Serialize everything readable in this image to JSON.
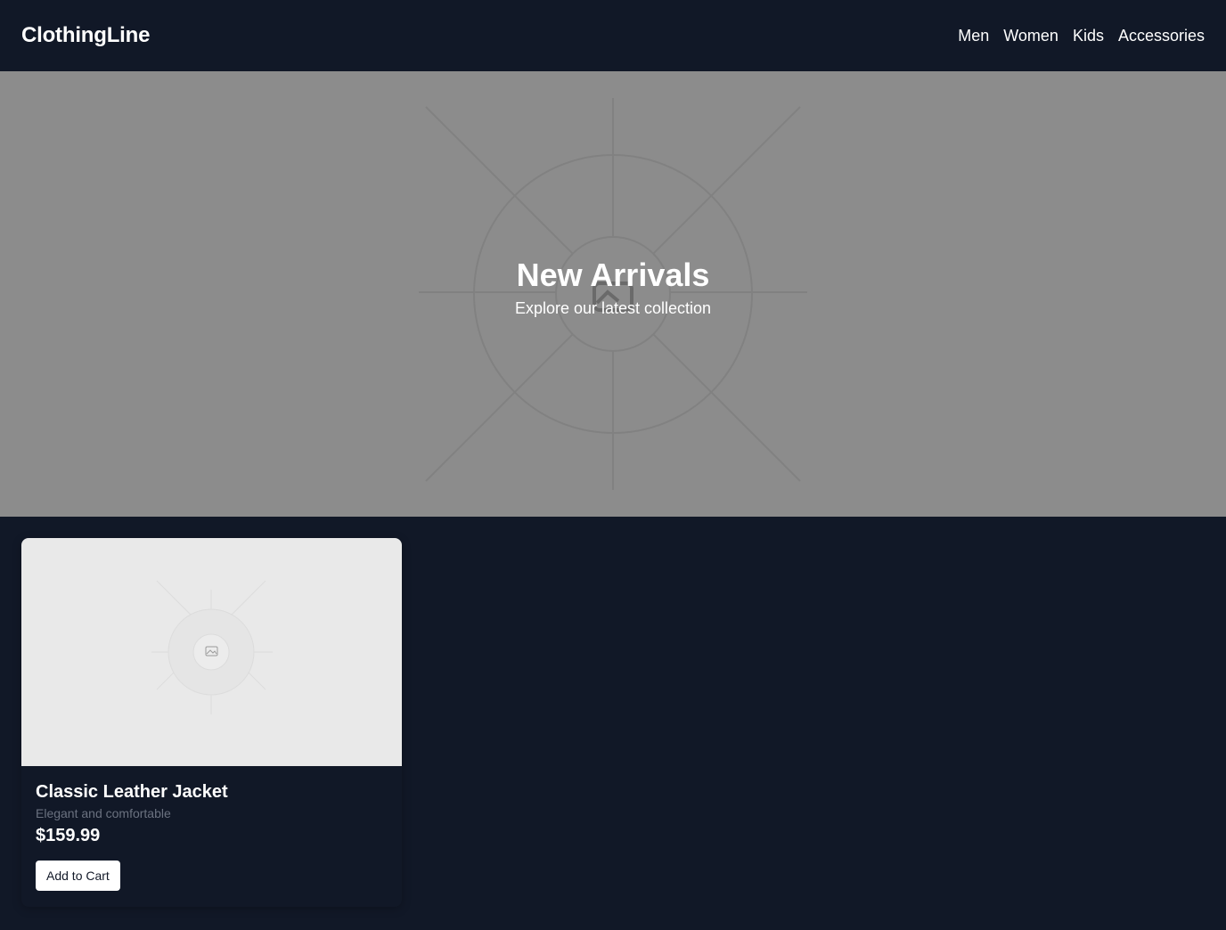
{
  "header": {
    "brand": "ClothingLine",
    "nav": [
      {
        "label": "Men"
      },
      {
        "label": "Women"
      },
      {
        "label": "Kids"
      },
      {
        "label": "Accessories"
      }
    ]
  },
  "hero": {
    "title": "New Arrivals",
    "subtitle": "Explore our latest collection",
    "image_icon": "image-placeholder-icon"
  },
  "products": [
    {
      "name": "Classic Leather Jacket",
      "description": "Elegant and comfortable",
      "price": "$159.99",
      "button_label": "Add to Cart",
      "image_icon": "image-placeholder-icon"
    }
  ],
  "colors": {
    "background": "#111827",
    "hero_background": "#8c8c8c",
    "card_image_background": "#e9e9e9",
    "muted_text": "#6b7280",
    "button_background": "#ffffff"
  }
}
